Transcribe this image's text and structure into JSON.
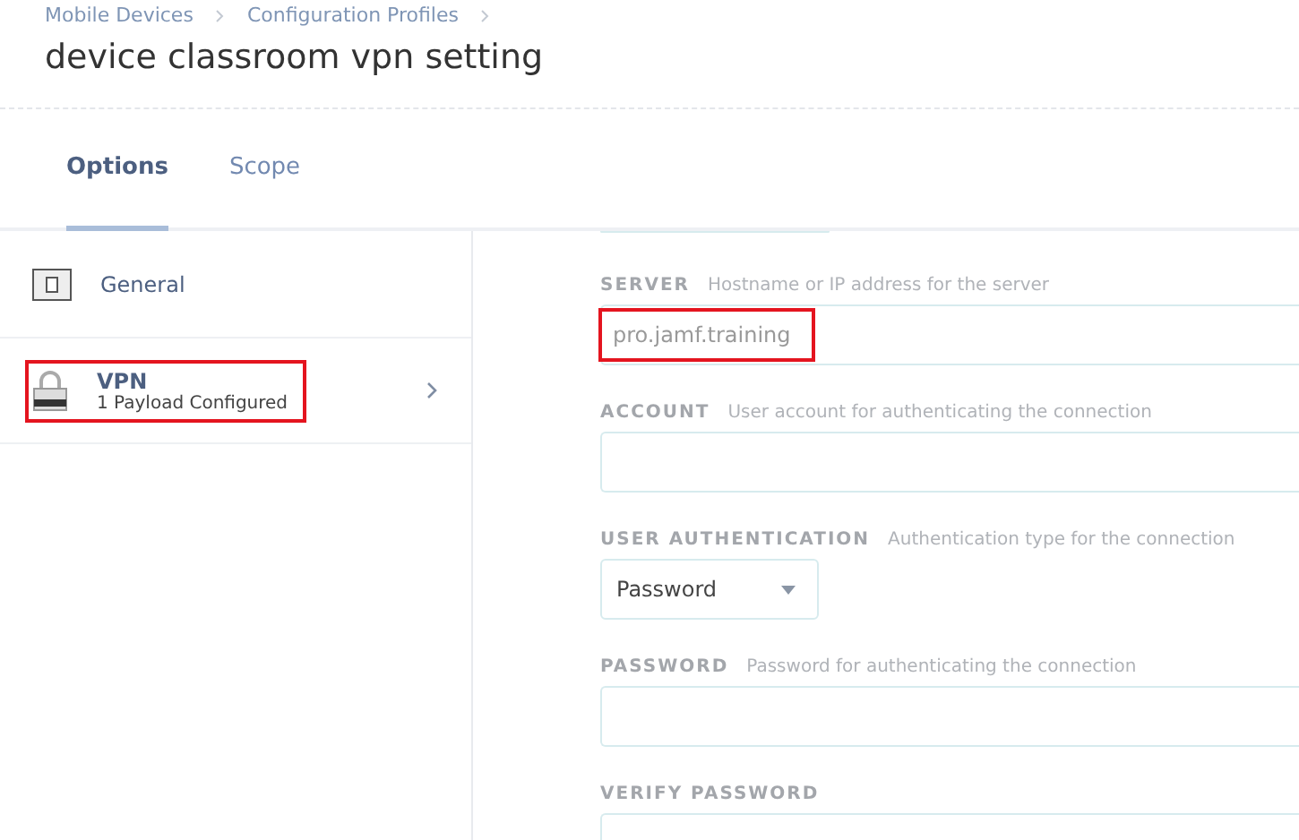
{
  "breadcrumbs": [
    "Mobile Devices",
    "Configuration Profiles"
  ],
  "title": "device classroom vpn setting",
  "tabs": [
    {
      "label": "Options",
      "selected": true
    },
    {
      "label": "Scope",
      "selected": false
    }
  ],
  "sidebar": {
    "items": [
      {
        "kind": "general",
        "label": "General",
        "highlighted": false
      },
      {
        "kind": "vpn",
        "label": "VPN",
        "detail": "1 Payload Configured",
        "highlighted": true
      }
    ]
  },
  "form": {
    "fields": [
      {
        "kind": "select-stub"
      },
      {
        "kind": "text",
        "label": "SERVER",
        "hint": "Hostname or IP address for the server",
        "value": "pro.jamf.training",
        "highlighted": true
      },
      {
        "kind": "text",
        "label": "ACCOUNT",
        "hint": "User account for authenticating the connection"
      },
      {
        "kind": "select",
        "label": "USER AUTHENTICATION",
        "hint": "Authentication type for the connection",
        "value": "Password"
      },
      {
        "kind": "text",
        "label": "PASSWORD",
        "hint": "Password for authenticating the connection"
      },
      {
        "kind": "text",
        "label": "VERIFY PASSWORD"
      }
    ]
  }
}
